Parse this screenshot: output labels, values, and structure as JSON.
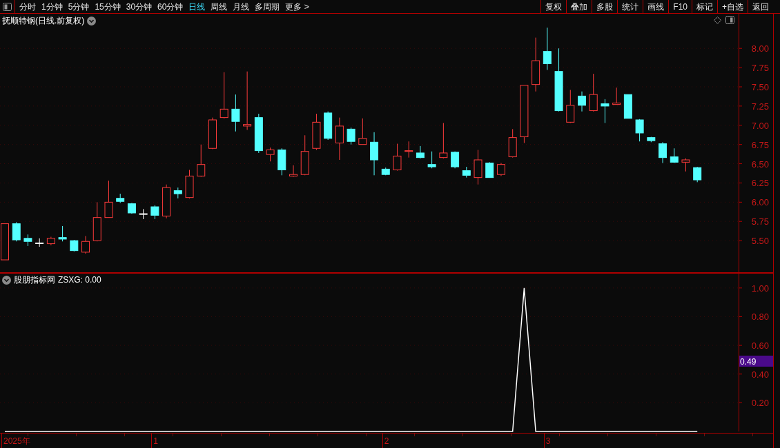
{
  "toolbar": {
    "tabs": [
      {
        "label": "分时",
        "selected": false
      },
      {
        "label": "1分钟",
        "selected": false
      },
      {
        "label": "5分钟",
        "selected": false
      },
      {
        "label": "15分钟",
        "selected": false
      },
      {
        "label": "30分钟",
        "selected": false
      },
      {
        "label": "60分钟",
        "selected": false
      },
      {
        "label": "日线",
        "selected": true
      },
      {
        "label": "周线",
        "selected": false
      },
      {
        "label": "月线",
        "selected": false
      },
      {
        "label": "多周期",
        "selected": false
      },
      {
        "label": "更多 >",
        "selected": false
      }
    ],
    "buttons": [
      "复权",
      "叠加",
      "多股",
      "统计",
      "画线",
      "F10",
      "标记",
      "+自选",
      "返回"
    ]
  },
  "price_panel": {
    "title": "抚顺特钢(日线.前复权)",
    "chart_data": {
      "type": "candlestick",
      "grid": true,
      "ylim": [
        5.08,
        8.45
      ],
      "categories": [
        null,
        null,
        null,
        null,
        null,
        null,
        null,
        null,
        null,
        null,
        null,
        null,
        null,
        null,
        null,
        null,
        null,
        null,
        null,
        null,
        null,
        null,
        null,
        null,
        null,
        null,
        null,
        null,
        null,
        null,
        null,
        null,
        null,
        null,
        null,
        null,
        null,
        null,
        null,
        null,
        null,
        null,
        null,
        null,
        null,
        null,
        null,
        null,
        null,
        null,
        null,
        null,
        null,
        null,
        null,
        null,
        null,
        null,
        null,
        null,
        null
      ],
      "yticks": [
        {
          "value": 8,
          "label": "8.00"
        },
        {
          "value": 7.75,
          "label": "7.75"
        },
        {
          "value": 7.5,
          "label": "7.50"
        },
        {
          "value": 7.25,
          "label": "7.25"
        },
        {
          "value": 7,
          "label": "7.00"
        },
        {
          "value": 6.75,
          "label": "6.75"
        },
        {
          "value": 6.5,
          "label": "6.50"
        },
        {
          "value": 6.25,
          "label": "6.25"
        },
        {
          "value": 6,
          "label": "6.00"
        },
        {
          "value": 5.75,
          "label": "5.75"
        },
        {
          "value": 5.5,
          "label": "5.50"
        }
      ],
      "ohlc": [
        [
          5.25,
          5.72,
          5.25,
          5.72
        ],
        [
          5.72,
          5.74,
          5.49,
          5.51
        ],
        [
          5.53,
          5.58,
          5.43,
          5.49
        ],
        [
          5.47,
          5.53,
          5.42,
          5.47
        ],
        [
          5.46,
          5.55,
          5.44,
          5.53
        ],
        [
          5.54,
          5.69,
          5.49,
          5.52
        ],
        [
          5.5,
          5.51,
          5.36,
          5.37
        ],
        [
          5.35,
          5.56,
          5.33,
          5.49
        ],
        [
          5.5,
          6.0,
          5.49,
          5.8
        ],
        [
          5.8,
          6.28,
          5.8,
          6.0
        ],
        [
          6.05,
          6.11,
          5.99,
          6.01
        ],
        [
          5.98,
          5.99,
          5.85,
          5.86
        ],
        [
          5.85,
          5.91,
          5.78,
          5.85
        ],
        [
          5.94,
          5.96,
          5.78,
          5.83
        ],
        [
          5.82,
          6.23,
          5.79,
          6.19
        ],
        [
          6.15,
          6.19,
          6.05,
          6.11
        ],
        [
          6.06,
          6.42,
          6.05,
          6.34
        ],
        [
          6.34,
          6.75,
          6.33,
          6.49
        ],
        [
          6.7,
          7.1,
          6.69,
          7.07
        ],
        [
          7.1,
          7.69,
          7.09,
          7.21
        ],
        [
          7.21,
          7.4,
          6.92,
          7.05
        ],
        [
          6.99,
          7.7,
          6.94,
          7.01
        ],
        [
          7.1,
          7.15,
          6.64,
          6.67
        ],
        [
          6.62,
          6.71,
          6.53,
          6.68
        ],
        [
          6.68,
          6.7,
          6.35,
          6.42
        ],
        [
          6.34,
          6.48,
          6.33,
          6.36
        ],
        [
          6.36,
          6.87,
          6.35,
          6.66
        ],
        [
          6.7,
          7.15,
          6.68,
          7.04
        ],
        [
          7.16,
          7.18,
          6.81,
          6.83
        ],
        [
          6.77,
          7.1,
          6.55,
          6.99
        ],
        [
          6.95,
          6.97,
          6.75,
          6.79
        ],
        [
          6.75,
          7.09,
          6.75,
          6.83
        ],
        [
          6.78,
          6.91,
          6.35,
          6.55
        ],
        [
          6.43,
          6.45,
          6.35,
          6.36
        ],
        [
          6.42,
          6.76,
          6.41,
          6.6
        ],
        [
          6.66,
          6.79,
          6.58,
          6.67
        ],
        [
          6.64,
          6.73,
          6.57,
          6.58
        ],
        [
          6.49,
          6.66,
          6.44,
          6.46
        ],
        [
          6.58,
          7.03,
          6.57,
          6.64
        ],
        [
          6.65,
          6.66,
          6.44,
          6.46
        ],
        [
          6.41,
          6.46,
          6.32,
          6.35
        ],
        [
          6.32,
          6.68,
          6.23,
          6.55
        ],
        [
          6.51,
          6.52,
          6.32,
          6.32
        ],
        [
          6.36,
          6.51,
          6.34,
          6.49
        ],
        [
          6.59,
          6.95,
          6.58,
          6.84
        ],
        [
          6.85,
          7.52,
          6.77,
          7.52
        ],
        [
          7.53,
          8.14,
          7.44,
          7.84
        ],
        [
          7.96,
          8.27,
          7.72,
          7.8
        ],
        [
          7.7,
          8.0,
          7.18,
          7.19
        ],
        [
          7.04,
          7.46,
          7.03,
          7.26
        ],
        [
          7.38,
          7.44,
          7.18,
          7.26
        ],
        [
          7.19,
          7.67,
          7.18,
          7.4
        ],
        [
          7.28,
          7.34,
          7.03,
          7.25
        ],
        [
          7.27,
          7.49,
          7.27,
          7.29
        ],
        [
          7.4,
          7.4,
          7.09,
          7.09
        ],
        [
          7.07,
          7.08,
          6.79,
          6.9
        ],
        [
          6.84,
          6.85,
          6.78,
          6.8
        ],
        [
          6.76,
          6.78,
          6.51,
          6.58
        ],
        [
          6.59,
          6.7,
          6.51,
          6.52
        ],
        [
          6.52,
          6.57,
          6.4,
          6.55
        ],
        [
          6.45,
          6.46,
          6.26,
          6.29
        ]
      ]
    }
  },
  "indicator_panel": {
    "name": "股朋指标网",
    "value_label": ": 0.00",
    "cursor_value": "0.49",
    "chart_data": {
      "type": "line",
      "grid": true,
      "ylim": [
        0,
        1.1
      ],
      "categories": [
        null,
        null,
        null,
        null,
        null,
        null,
        null,
        null,
        null,
        null,
        null,
        null,
        null,
        null,
        null,
        null,
        null,
        null,
        null,
        null,
        null,
        null,
        null,
        null,
        null,
        null,
        null,
        null,
        null,
        null,
        null,
        null,
        null,
        null,
        null,
        null,
        null,
        null,
        null,
        null,
        null,
        null,
        null,
        null,
        null,
        null,
        null,
        null,
        null,
        null,
        null,
        null,
        null,
        null,
        null,
        null,
        null,
        null,
        null,
        null,
        null
      ],
      "yticks": [
        {
          "value": 1,
          "label": "1.00"
        },
        {
          "value": 0.8,
          "label": "0.80"
        },
        {
          "value": 0.6,
          "label": "0.60"
        },
        {
          "value": 0.4,
          "label": "0.40"
        },
        {
          "value": 0.2,
          "label": "0.20"
        }
      ],
      "series": [
        {
          "name": "ZSXG",
          "color": "#ffffff",
          "values": [
            0,
            0,
            0,
            0,
            0,
            0,
            0,
            0,
            0,
            0,
            0,
            0,
            0,
            0,
            0,
            0,
            0,
            0,
            0,
            0,
            0,
            0,
            0,
            0,
            0,
            0,
            0,
            0,
            0,
            0,
            0,
            0,
            0,
            0,
            0,
            0,
            0,
            0,
            0,
            0,
            0,
            0,
            0,
            0,
            0,
            1,
            0,
            0,
            0,
            0,
            0,
            0,
            0,
            0,
            0,
            0,
            0,
            0,
            0,
            0,
            0
          ]
        }
      ]
    }
  },
  "date_axis": [
    "2025年",
    "1",
    "2",
    "3"
  ]
}
